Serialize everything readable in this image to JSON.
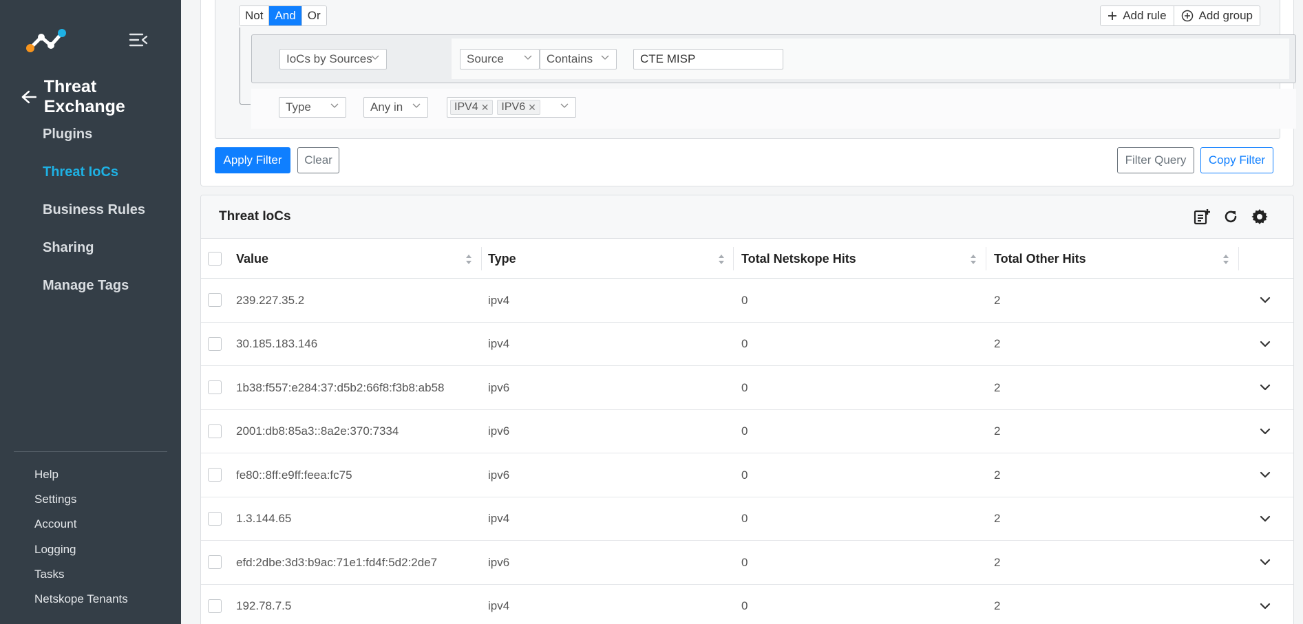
{
  "sidebar": {
    "page_title": "Threat Exchange",
    "nav": [
      {
        "label": "Plugins",
        "active": false
      },
      {
        "label": "Threat IoCs",
        "active": true
      },
      {
        "label": "Business Rules",
        "active": false
      },
      {
        "label": "Sharing",
        "active": false
      },
      {
        "label": "Manage Tags",
        "active": false
      }
    ],
    "bottom": [
      "Help",
      "Settings",
      "Account",
      "Logging",
      "Tasks",
      "Netskope Tenants"
    ]
  },
  "filter": {
    "logic": {
      "not": "Not",
      "and": "And",
      "or": "Or"
    },
    "add_rule": "Add rule",
    "add_group": "Add group",
    "rule1": {
      "field": "IoCs by Sources",
      "subfield": "Source",
      "operator": "Contains",
      "value": "CTE MISP"
    },
    "rule2": {
      "field": "Type",
      "operator": "Any in",
      "tags": [
        "IPV4",
        "IPV6"
      ]
    },
    "apply": "Apply Filter",
    "clear": "Clear",
    "filter_query": "Filter Query",
    "copy_filter": "Copy Filter"
  },
  "table": {
    "title": "Threat IoCs",
    "columns": [
      "Value",
      "Type",
      "Total Netskope Hits",
      "Total Other Hits"
    ],
    "rows": [
      {
        "value": "239.227.35.2",
        "type": "ipv4",
        "netskope_hits": "0",
        "other_hits": "2"
      },
      {
        "value": "30.185.183.146",
        "type": "ipv4",
        "netskope_hits": "0",
        "other_hits": "2"
      },
      {
        "value": "1b38:f557:e284:37:d5b2:66f8:f3b8:ab58",
        "type": "ipv6",
        "netskope_hits": "0",
        "other_hits": "2"
      },
      {
        "value": "2001:db8:85a3::8a2e:370:7334",
        "type": "ipv6",
        "netskope_hits": "0",
        "other_hits": "2"
      },
      {
        "value": "fe80::8ff:e9ff:feea:fc75",
        "type": "ipv6",
        "netskope_hits": "0",
        "other_hits": "2"
      },
      {
        "value": "1.3.144.65",
        "type": "ipv4",
        "netskope_hits": "0",
        "other_hits": "2"
      },
      {
        "value": "efd:2dbe:3d3:b9ac:71e1:fd4f:5d2:2de7",
        "type": "ipv6",
        "netskope_hits": "0",
        "other_hits": "2"
      },
      {
        "value": "192.78.7.5",
        "type": "ipv4",
        "netskope_hits": "0",
        "other_hits": "2"
      }
    ]
  },
  "colors": {
    "accent": "#0f7fff",
    "sidebar_bg": "#343e47",
    "active_nav": "#1eb1e4",
    "logo_orange": "#f7941d",
    "logo_blue": "#1eb1e4"
  }
}
